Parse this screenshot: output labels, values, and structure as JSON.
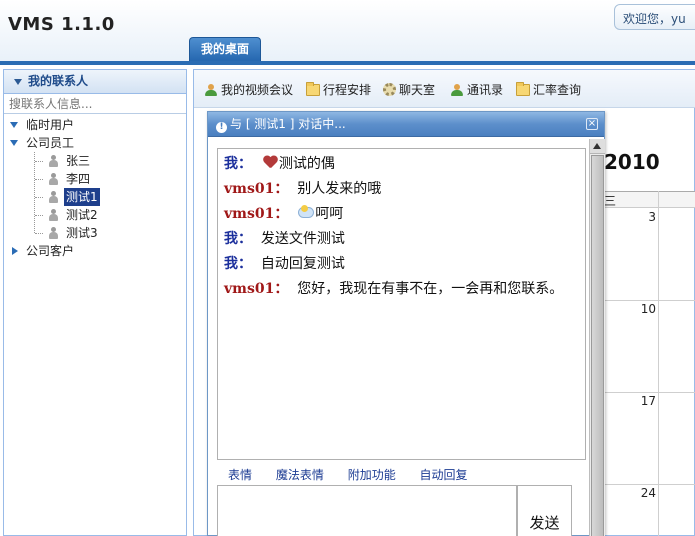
{
  "app": {
    "title": "VMS 1.1.0",
    "welcome": "欢迎您，yu"
  },
  "tabs": {
    "desktop": "我的桌面"
  },
  "sidebar": {
    "header": "我的联系人",
    "search_placeholder": "搜联系人信息...",
    "groups": [
      {
        "label": "临时用户"
      },
      {
        "label": "公司员工"
      },
      {
        "label": "公司客户"
      }
    ],
    "members": [
      {
        "label": "张三"
      },
      {
        "label": "李四"
      },
      {
        "label": "测试1"
      },
      {
        "label": "测试2"
      },
      {
        "label": "测试3"
      }
    ]
  },
  "toolbar": {
    "items": [
      {
        "label": "我的视频会议",
        "icon": "video-meeting-icon"
      },
      {
        "label": "行程安排",
        "icon": "folder-icon"
      },
      {
        "label": "聊天室",
        "icon": "chat-room-icon"
      },
      {
        "label": "通讯录",
        "icon": "address-book-icon"
      },
      {
        "label": "汇率查询",
        "icon": "folder-icon"
      }
    ]
  },
  "calendar": {
    "title_fragment": "2010",
    "weekday": "三",
    "days": [
      "3",
      "10",
      "17",
      "24"
    ]
  },
  "dialog": {
    "title": "与 [ 测试1 ] 对话中...",
    "close": "×",
    "messages": [
      {
        "sender": "我：",
        "text": "测试的偶",
        "emote": "broken-heart-icon"
      },
      {
        "sender": "vms01：",
        "text": "别人发来的哦",
        "emote": ""
      },
      {
        "sender": "vms01：",
        "text": "呵呵",
        "emote": "cloudy-icon"
      },
      {
        "sender": "我：",
        "text": "发送文件测试",
        "emote": ""
      },
      {
        "sender": "我：",
        "text": "自动回复测试",
        "emote": ""
      },
      {
        "sender": "vms01：",
        "text": "您好，我现在有事不在，一会再和您联系。",
        "emote": ""
      }
    ],
    "links": [
      "表情",
      "魔法表情",
      "附加功能",
      "自动回复"
    ],
    "send_label": "发送"
  }
}
